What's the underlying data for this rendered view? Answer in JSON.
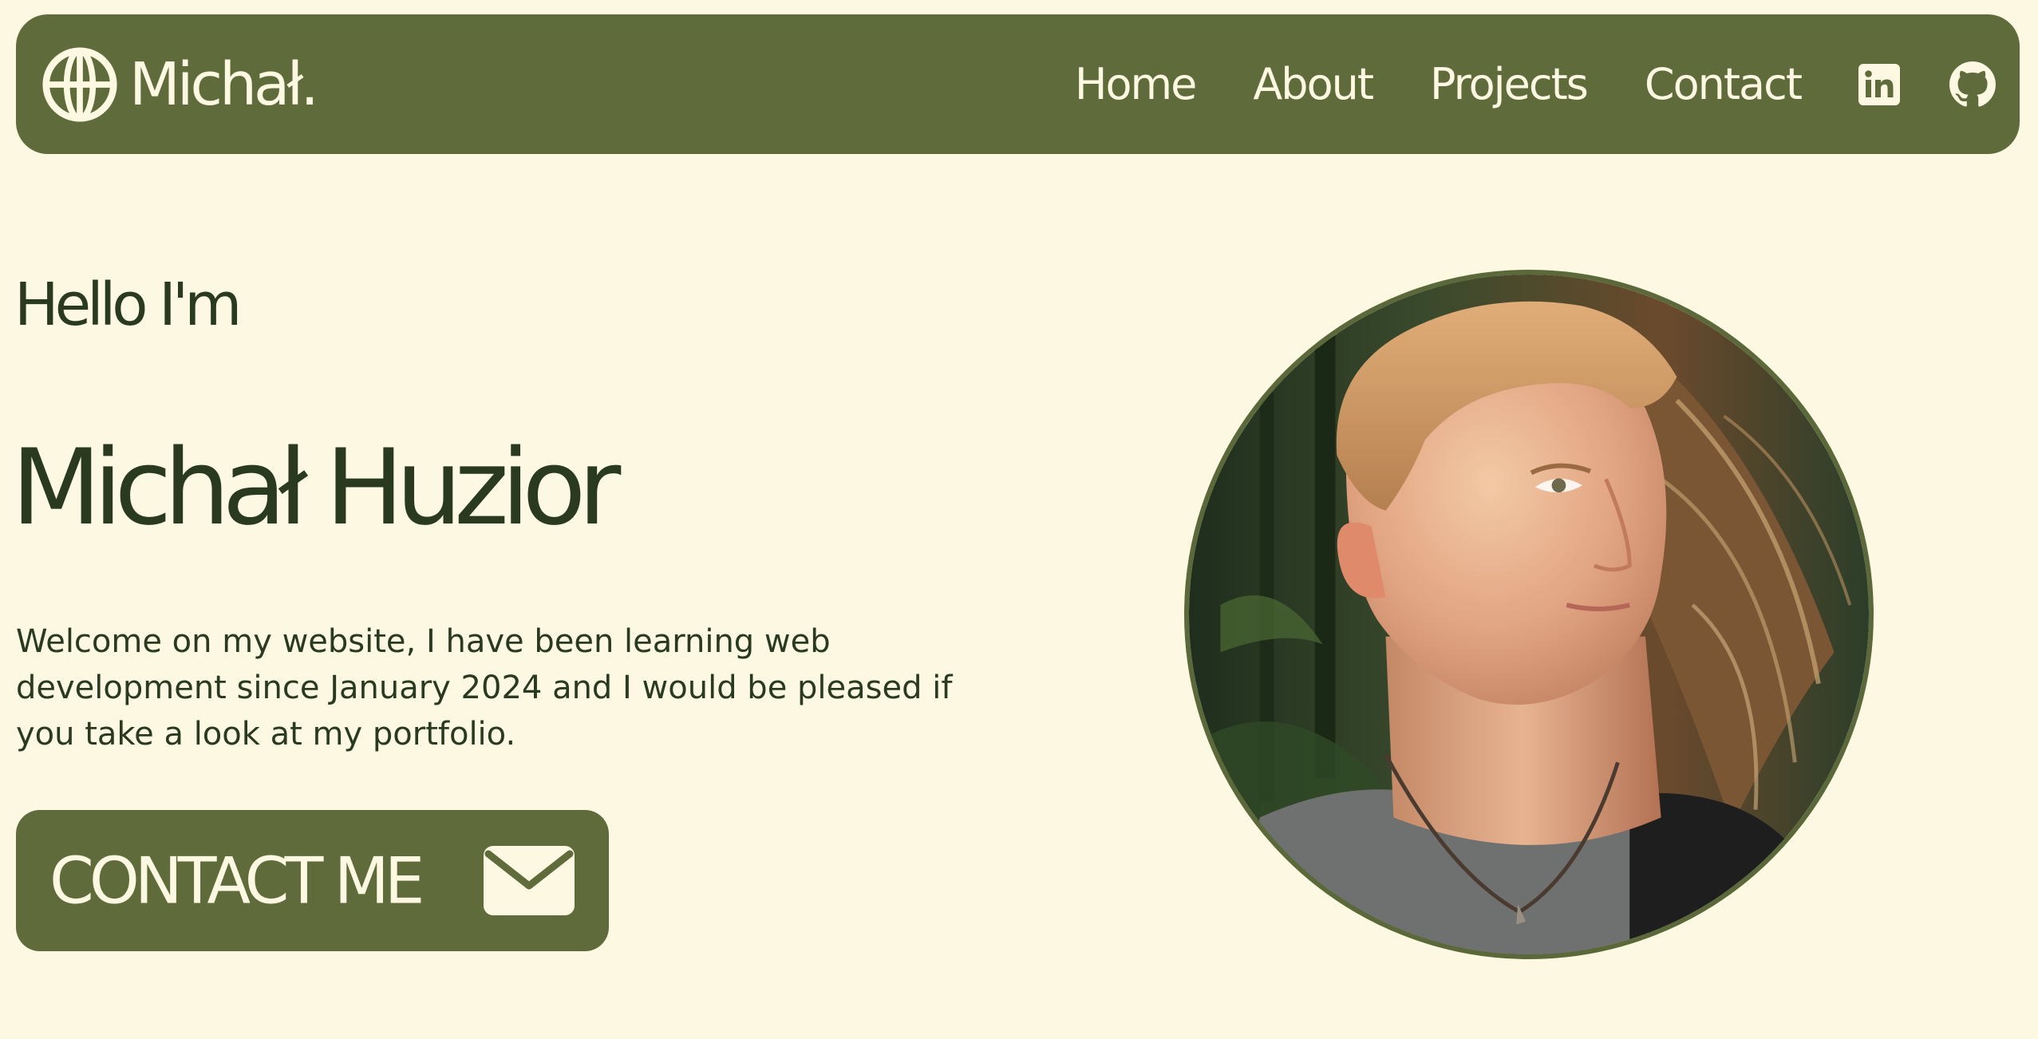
{
  "colors": {
    "background": "#fcf8e1",
    "accent": "#606b3b",
    "text_dark": "#2a3a1f",
    "text_light": "#fcf8e1"
  },
  "navbar": {
    "logo": {
      "icon": "globe-icon",
      "text": "Michał."
    },
    "links": [
      {
        "label": "Home"
      },
      {
        "label": "About"
      },
      {
        "label": "Projects"
      },
      {
        "label": "Contact"
      }
    ],
    "social": [
      {
        "icon": "linkedin-icon"
      },
      {
        "icon": "github-icon"
      }
    ]
  },
  "hero": {
    "greeting": "Hello I'm",
    "name": "Michał Huzior",
    "intro": "Welcome on my website, I have been learning web development since January 2024 and I would be pleased if you take a look at my portfolio.",
    "cta": {
      "label": "CONTACT ME",
      "icon": "mail-icon"
    },
    "portrait": {
      "icon": "profile-photo"
    }
  }
}
